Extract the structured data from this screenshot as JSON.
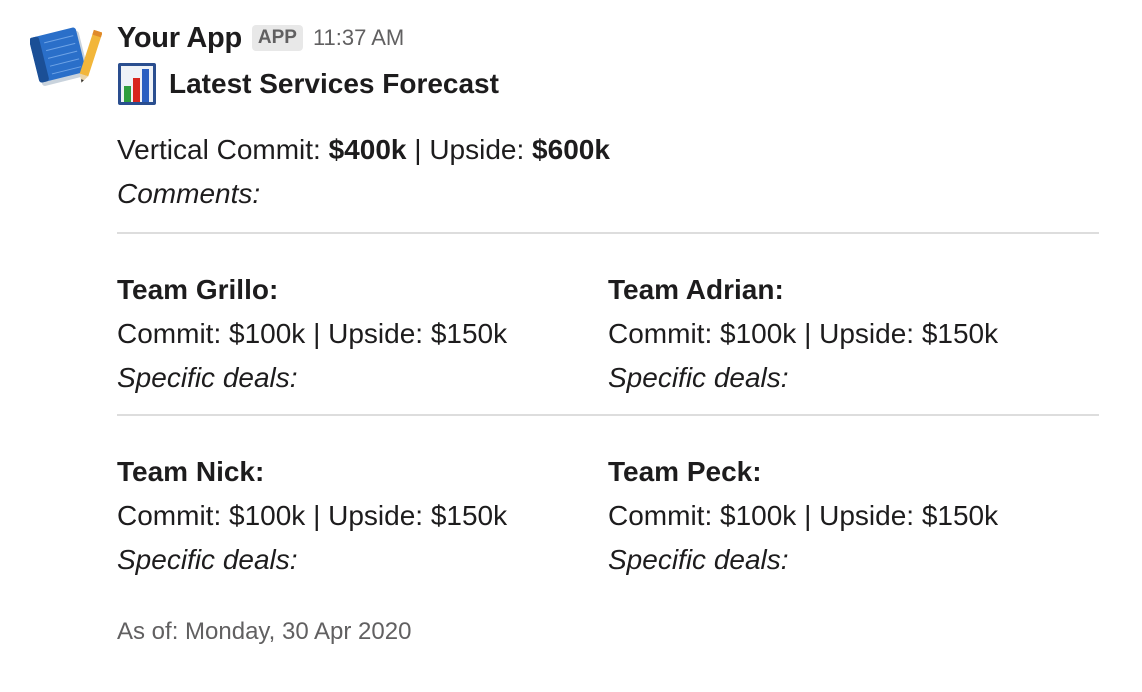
{
  "app": {
    "name": "Your App",
    "badge": "APP",
    "timestamp": "11:37 AM",
    "avatar_icon": "blueprint-pencil-icon"
  },
  "message": {
    "title_icon": "bar-chart-icon",
    "title": "Latest Services Forecast",
    "summary": {
      "commit_label": "Vertical Commit: ",
      "commit_value": "$400k",
      "separator": " | Upside: ",
      "upside_value": "$600k"
    },
    "comments_label": "Comments:",
    "teams": [
      {
        "name": "Team Grillo:",
        "line": "Commit: $100k | Upside: $150k",
        "deals": "Specific deals:"
      },
      {
        "name": "Team Adrian:",
        "line": "Commit: $100k | Upside: $150k",
        "deals": "Specific deals:"
      },
      {
        "name": "Team Nick:",
        "line": "Commit: $100k | Upside: $150k",
        "deals": "Specific deals:"
      },
      {
        "name": "Team Peck:",
        "line": "Commit: $100k | Upside: $150k",
        "deals": "Specific deals:"
      }
    ],
    "footer": "As of: Monday, 30 Apr 2020"
  },
  "colors": {
    "text": "#1d1c1d",
    "muted": "#616061",
    "divider": "#dddddd",
    "badge_bg": "#e8e8e8"
  }
}
